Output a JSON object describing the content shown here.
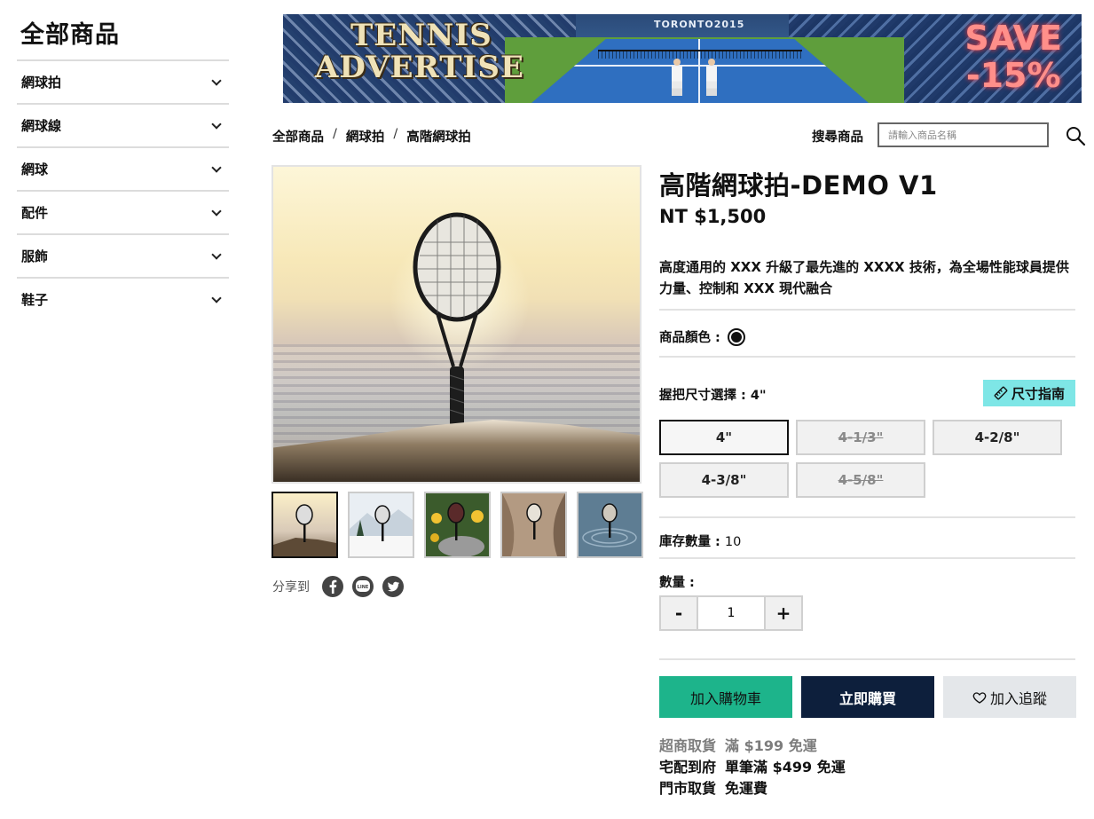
{
  "sidebar": {
    "title": "全部商品",
    "items": [
      {
        "label": "網球拍"
      },
      {
        "label": "網球線"
      },
      {
        "label": "網球"
      },
      {
        "label": "配件"
      },
      {
        "label": "服飾"
      },
      {
        "label": "鞋子"
      }
    ]
  },
  "banner": {
    "title_line1": "TENNIS",
    "title_line2": "ADVERTISE",
    "venue": "TORONTO2015",
    "promo_line1": "SAVE",
    "promo_line2": "-15%"
  },
  "breadcrumb": {
    "items": [
      "全部商品",
      "網球拍",
      "高階網球拍"
    ],
    "separator": "/"
  },
  "search": {
    "label": "搜尋商品",
    "placeholder": "請輸入商品名稱",
    "icon": "search-icon"
  },
  "product": {
    "title": "高階網球拍-DEMO V1",
    "price": "NT $1,500",
    "description": "高度通用的 XXX 升級了最先進的 XXXX 技術，為全場性能球員提供力量、控制和 XXX 現代融合",
    "color_label": "商品顏色 :",
    "grip_label": "握把尺寸選擇 : 4\"",
    "size_guide_label": "尺寸指南",
    "size_options": [
      {
        "label": "4\"",
        "state": "selected"
      },
      {
        "label": "4-1/3\"",
        "state": "unavailable"
      },
      {
        "label": "4-2/8\"",
        "state": "available"
      },
      {
        "label": "4-3/8\"",
        "state": "available"
      },
      {
        "label": "4-5/8\"",
        "state": "unavailable"
      }
    ],
    "stock_label": "庫存數量 :",
    "stock_value": "10",
    "quantity_label": "數量 :",
    "quantity_value": "1",
    "minus_label": "-",
    "plus_label": "+"
  },
  "share": {
    "label": "分享到",
    "icons": [
      "facebook-icon",
      "line-icon",
      "twitter-icon"
    ]
  },
  "actions": {
    "add_to_cart": "加入購物車",
    "buy_now": "立即購買",
    "add_to_wishlist": "加入追蹤"
  },
  "shipping": [
    {
      "method": "超商取貨",
      "note": "滿 $199 免運"
    },
    {
      "method": "宅配到府",
      "note": "單筆滿 $499 免運"
    },
    {
      "method": "門市取貨",
      "note": "免運費"
    }
  ],
  "colors": {
    "cart_button": "#1db48b",
    "buy_button": "#0d1f3c",
    "wishlist_button": "#e4e7ea",
    "size_guide": "#7ee6e6"
  }
}
